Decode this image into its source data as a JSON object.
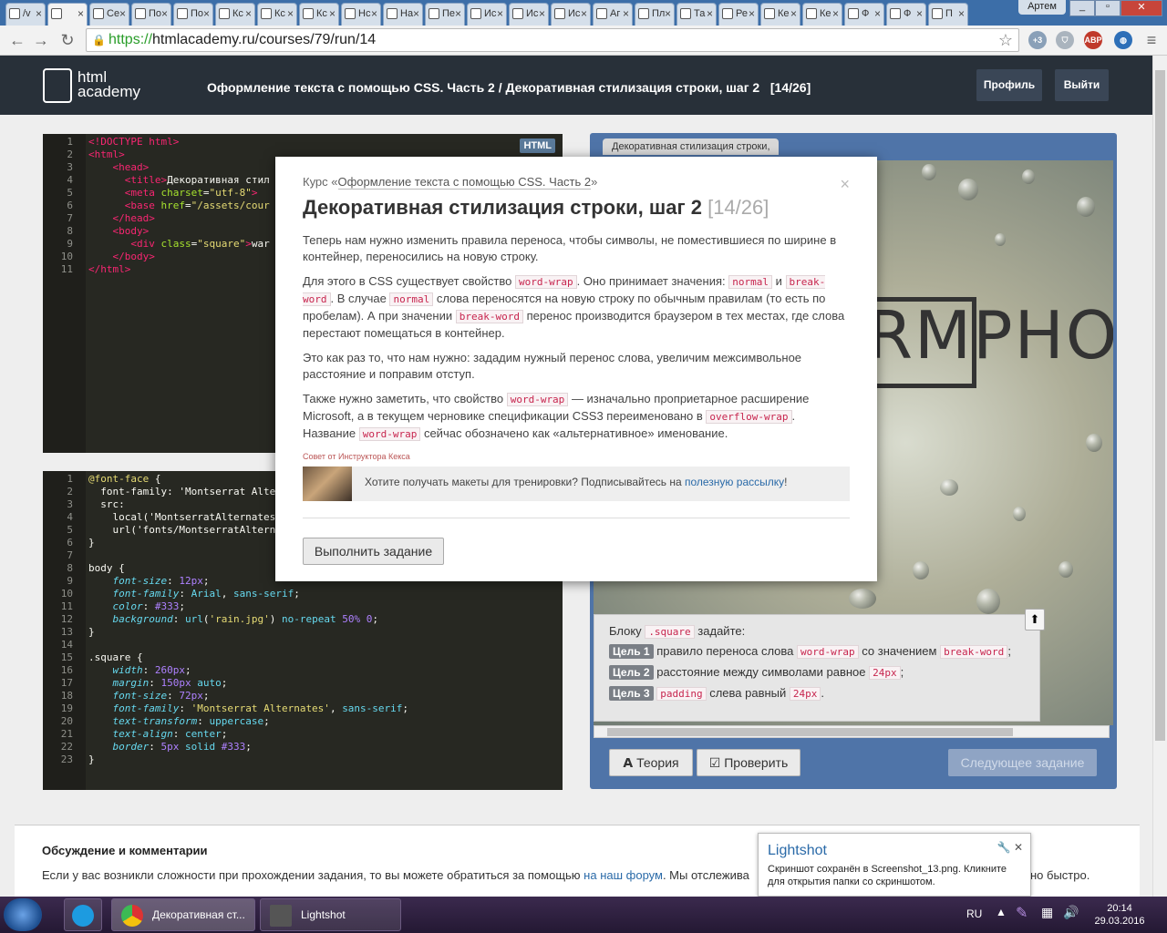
{
  "browser": {
    "tabs": [
      {
        "label": "/v",
        "active": false
      },
      {
        "label": "",
        "active": true
      },
      {
        "label": "Ce",
        "active": false
      },
      {
        "label": "По",
        "active": false
      },
      {
        "label": "По",
        "active": false
      },
      {
        "label": "Кс",
        "active": false
      },
      {
        "label": "Кс",
        "active": false
      },
      {
        "label": "Кс",
        "active": false
      },
      {
        "label": "Нс",
        "active": false
      },
      {
        "label": "На",
        "active": false
      },
      {
        "label": "Пе",
        "active": false
      },
      {
        "label": "Ис",
        "active": false
      },
      {
        "label": "Ис",
        "active": false
      },
      {
        "label": "Ис",
        "active": false
      },
      {
        "label": "Аг",
        "active": false
      },
      {
        "label": "Пл",
        "active": false
      },
      {
        "label": "Та",
        "active": false
      },
      {
        "label": "Ре",
        "active": false
      },
      {
        "label": "Ке",
        "active": false
      },
      {
        "label": "Ке",
        "active": false
      },
      {
        "label": "Ф",
        "active": false
      },
      {
        "label": "Ф",
        "active": false
      },
      {
        "label": "П",
        "active": false
      }
    ],
    "user": "Артем",
    "url_scheme": "https://",
    "url_rest": "htmlacademy.ru/courses/79/run/14",
    "ext_badge": "+3",
    "abp": "ABP"
  },
  "site": {
    "logo_line1": "html",
    "logo_line2": "academy",
    "course_title": "Оформление текста с помощью CSS. Часть 2 / Декоративная стилизация строки, шаг 2   [14/26]",
    "profile_btn": "Профиль",
    "logout_btn": "Выйти"
  },
  "html_editor": {
    "badge": "HTML",
    "line_numbers": "1\n2\n3\n4\n5\n6\n7\n8\n9\n10\n11"
  },
  "css_editor": {
    "line_numbers": "1\n2\n3\n4\n5\n6\n7\n8\n9\n10\n11\n12\n13\n14\n15\n16\n17\n18\n19\n20\n21\n22\n23"
  },
  "preview": {
    "tab_label": "Декоративная стилизация строки,",
    "square_text": "RMPHO",
    "task_intro_pre": "Блоку",
    "task_intro_code": ".square",
    "task_intro_post": "задайте:",
    "goals": [
      {
        "badge": "Цель 1",
        "pre": "правило переноса слова",
        "code1": "word-wrap",
        "mid": "со значением",
        "code2": "break-word",
        "post": ";"
      },
      {
        "badge": "Цель 2",
        "pre": "расстояние между символами равное",
        "code1": "24px",
        "post": ";"
      },
      {
        "badge": "Цель 3",
        "code1": "padding",
        "mid": "слева равный",
        "code2": "24px",
        "post": "."
      }
    ],
    "theory_btn": "Теория",
    "check_btn": "Проверить",
    "next_btn": "Следующее задание"
  },
  "modal": {
    "course_prefix": "Курс «",
    "course_link": "Оформление текста с помощью CSS. Часть 2",
    "course_suffix": "»",
    "title": "Декоративная стилизация строки, шаг 2",
    "step": "[14/26]",
    "p1": "Теперь нам нужно изменить правила переноса, чтобы символы, не поместившиеся по ширине в контейнер, переносились на новую строку.",
    "p2_a": "Для этого в CSS существует свойство",
    "p2_c1": "word-wrap",
    "p2_b": ". Оно принимает значения:",
    "p2_c2": "normal",
    "p2_and": "и",
    "p2_c3": "break-word",
    "p2_c": ". В случае",
    "p2_c4": "normal",
    "p2_d": "слова переносятся на новую строку по обычным правилам (то есть по пробелам). А при значении",
    "p2_c5": "break-word",
    "p2_e": "перенос производится браузером в тех местах, где слова перестают помещаться в контейнер.",
    "p3": "Это как раз то, что нам нужно: зададим нужный перенос слова, увеличим межсимвольное расстояние и поправим отступ.",
    "p4_a": "Также нужно заметить, что свойство",
    "p4_c1": "word-wrap",
    "p4_b": "— изначально проприетарное расширение Microsoft, а в текущем черновике спецификации CSS3 переименовано в",
    "p4_c2": "overflow-wrap",
    "p4_c": ". Название",
    "p4_c3": "word-wrap",
    "p4_d": "сейчас обозначено как «альтернативное» именование.",
    "advice_label": "Совет от Инструктора Кекса",
    "advice_text": "Хотите получать макеты для тренировки? Подписывайтесь на",
    "advice_link": "полезную рассылку",
    "advice_end": "!",
    "run_btn": "Выполнить задание",
    "close": "×"
  },
  "comments": {
    "title": "Обсуждение и комментарии",
    "text_a": "Если у вас возникли сложности при прохождении задания, то вы можете обратиться за помощью",
    "link": "на наш форум",
    "text_b": ". Мы отслежива",
    "text_c": "но быстро."
  },
  "toast": {
    "title": "Lightshot",
    "body": "Скриншот сохранён в Screenshot_13.png. Кликните для открытия папки со скриншотом."
  },
  "taskbar": {
    "chrome_task": "Декоративная ст...",
    "lightshot_task": "Lightshot",
    "lang": "RU",
    "time": "20:14",
    "date": "29.03.2016"
  },
  "colors": {
    "header_bg": "#283039",
    "preview_bg": "#4f74a8",
    "editor_bg": "#272822",
    "link": "#2a6aa8"
  }
}
